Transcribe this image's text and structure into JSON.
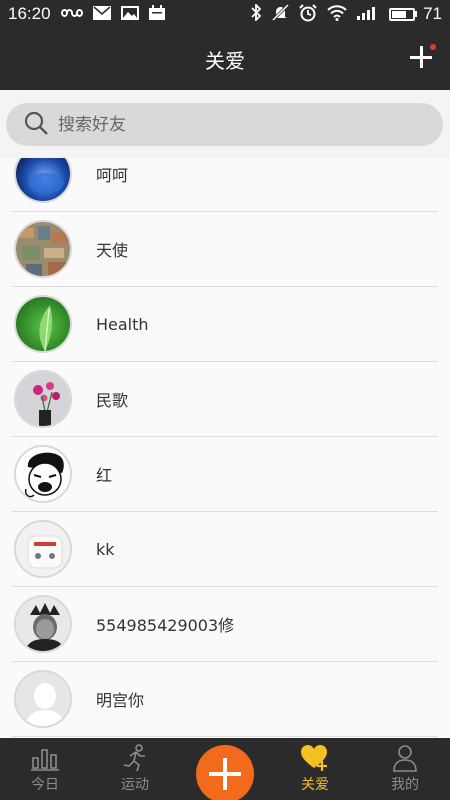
{
  "status_bar": {
    "time": "16:20",
    "battery_level": "71",
    "battery_fraction": 0.71,
    "left_icons": [
      "infinity-icon",
      "mail-icon",
      "image-icon",
      "calendar-icon"
    ],
    "right_icons": [
      "bluetooth-icon",
      "mute-icon",
      "alarm-icon",
      "wifi-icon",
      "signal-icon",
      "battery-icon"
    ]
  },
  "header": {
    "title": "关爱",
    "add_icon": "plus-icon",
    "notification_dot_color": "#e23a2d"
  },
  "search": {
    "placeholder": "搜索好友",
    "icon": "search-icon"
  },
  "friends": [
    {
      "name": "呵呵",
      "avatar": "blue-abstract-avatar"
    },
    {
      "name": "天使",
      "avatar": "city-aerial-avatar"
    },
    {
      "name": "Health",
      "avatar": "green-leaf-avatar"
    },
    {
      "name": "民歌",
      "avatar": "flowers-vase-avatar"
    },
    {
      "name": "红",
      "avatar": "cartoon-face-avatar"
    },
    {
      "name": "kk",
      "avatar": "white-product-avatar"
    },
    {
      "name": "554985429003修",
      "avatar": "dark-person-avatar"
    },
    {
      "name": "明宫你",
      "avatar": "default-person-avatar"
    }
  ],
  "tabs": [
    {
      "label": "今日",
      "icon": "bar-chart-icon",
      "active": false
    },
    {
      "label": "运动",
      "icon": "runner-icon",
      "active": false
    },
    {
      "label": "",
      "icon": "plus-icon",
      "active": false
    },
    {
      "label": "关爱",
      "icon": "heart-plus-icon",
      "active": true
    },
    {
      "label": "我的",
      "icon": "person-icon",
      "active": false
    }
  ],
  "colors": {
    "bar_background": "#2b2b2b",
    "accent_orange": "#f26b1d",
    "active_yellow": "#f5c022",
    "inactive_gray": "#8c8c8c"
  }
}
